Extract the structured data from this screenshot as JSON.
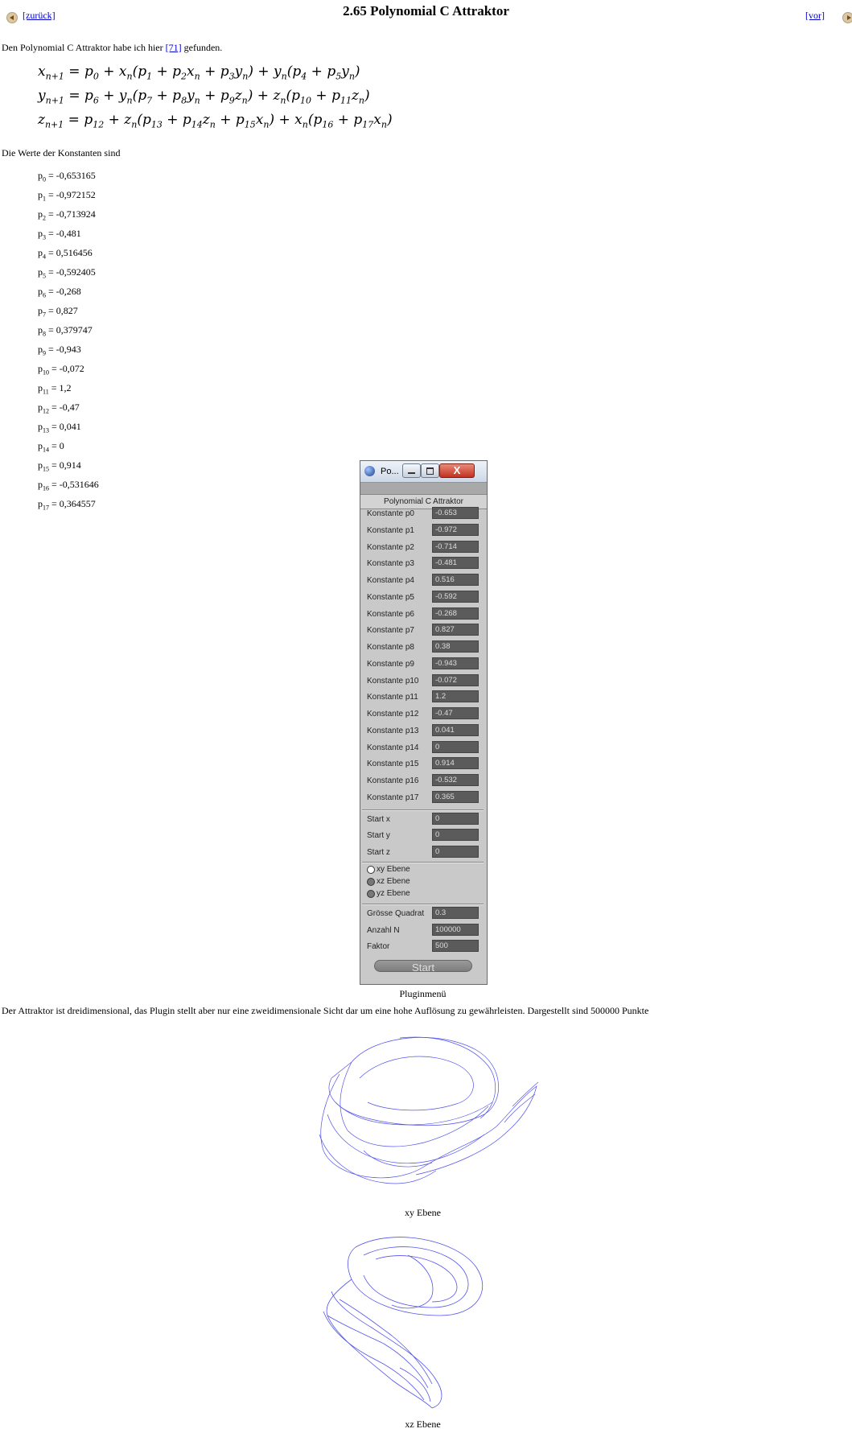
{
  "nav": {
    "back_label": "[zurück]",
    "forward_label": "[vor]",
    "page_title": "2.65 Polynomial C Attraktor"
  },
  "intro": {
    "before": "Den Polynomial C Attraktor habe ich hier ",
    "ref_link": "[71]",
    "after": " gefunden."
  },
  "consts_intro": "Die Werte der Konstanten sind",
  "constants": [
    {
      "idx": "0",
      "value": "-0,653165"
    },
    {
      "idx": "1",
      "value": "-0,972152"
    },
    {
      "idx": "2",
      "value": "-0,713924"
    },
    {
      "idx": "3",
      "value": "-0,481"
    },
    {
      "idx": "4",
      "value": "0,516456"
    },
    {
      "idx": "5",
      "value": "-0,592405"
    },
    {
      "idx": "6",
      "value": "-0,268"
    },
    {
      "idx": "7",
      "value": "0,827"
    },
    {
      "idx": "8",
      "value": "0,379747"
    },
    {
      "idx": "9",
      "value": "-0,943"
    },
    {
      "idx": "10",
      "value": "-0,072"
    },
    {
      "idx": "11",
      "value": "1,2"
    },
    {
      "idx": "12",
      "value": "-0,47"
    },
    {
      "idx": "13",
      "value": "0,041"
    },
    {
      "idx": "14",
      "value": "0"
    },
    {
      "idx": "15",
      "value": "0,914"
    },
    {
      "idx": "16",
      "value": "-0,531646"
    },
    {
      "idx": "17",
      "value": "0,364557"
    }
  ],
  "plugin": {
    "window_title": "Po...",
    "close_glyph": "X",
    "panel_title": "Polynomial C Attraktor",
    "params": [
      {
        "label": "Konstante p0",
        "value": "-0.653"
      },
      {
        "label": "Konstante p1",
        "value": "-0.972"
      },
      {
        "label": "Konstante p2",
        "value": "-0.714"
      },
      {
        "label": "Konstante p3",
        "value": "-0.481"
      },
      {
        "label": "Konstante p4",
        "value": "0.516"
      },
      {
        "label": "Konstante p5",
        "value": "-0.592"
      },
      {
        "label": "Konstante p6",
        "value": "-0.268"
      },
      {
        "label": "Konstante p7",
        "value": "0.827"
      },
      {
        "label": "Konstante p8",
        "value": "0.38"
      },
      {
        "label": "Konstante p9",
        "value": "-0.943"
      },
      {
        "label": "Konstante p10",
        "value": "-0.072"
      },
      {
        "label": "Konstante p11",
        "value": "1.2"
      },
      {
        "label": "Konstante p12",
        "value": "-0.47"
      },
      {
        "label": "Konstante p13",
        "value": "0.041"
      },
      {
        "label": "Konstante p14",
        "value": "0"
      },
      {
        "label": "Konstante p15",
        "value": "0.914"
      },
      {
        "label": "Konstante p16",
        "value": "-0.532"
      },
      {
        "label": "Konstante p17",
        "value": "0.365"
      }
    ],
    "starts": [
      {
        "label": "Start x",
        "value": "0"
      },
      {
        "label": "Start y",
        "value": "0"
      },
      {
        "label": "Start z",
        "value": "0"
      }
    ],
    "planes": [
      {
        "label": "xy Ebene",
        "selected": true
      },
      {
        "label": "xz Ebene",
        "selected": false
      },
      {
        "label": "yz Ebene",
        "selected": false
      }
    ],
    "extras": [
      {
        "label": "Grösse Quadrat",
        "value": "0.3"
      },
      {
        "label": "Anzahl N",
        "value": "100000"
      },
      {
        "label": "Faktor",
        "value": "500"
      }
    ],
    "start_button": "Start"
  },
  "plugin_caption": "Pluginmenü",
  "description": "Der Attraktor ist dreidimensional, das Plugin stellt aber nur eine zweidimensionale Sicht dar um eine hohe Auflösung zu gewährleisten. Dargestellt sind 500000 Punkte",
  "images": {
    "stroke_color": "#1a1ae6",
    "xy_caption": "xy Ebene",
    "xz_caption": "xz Ebene"
  }
}
